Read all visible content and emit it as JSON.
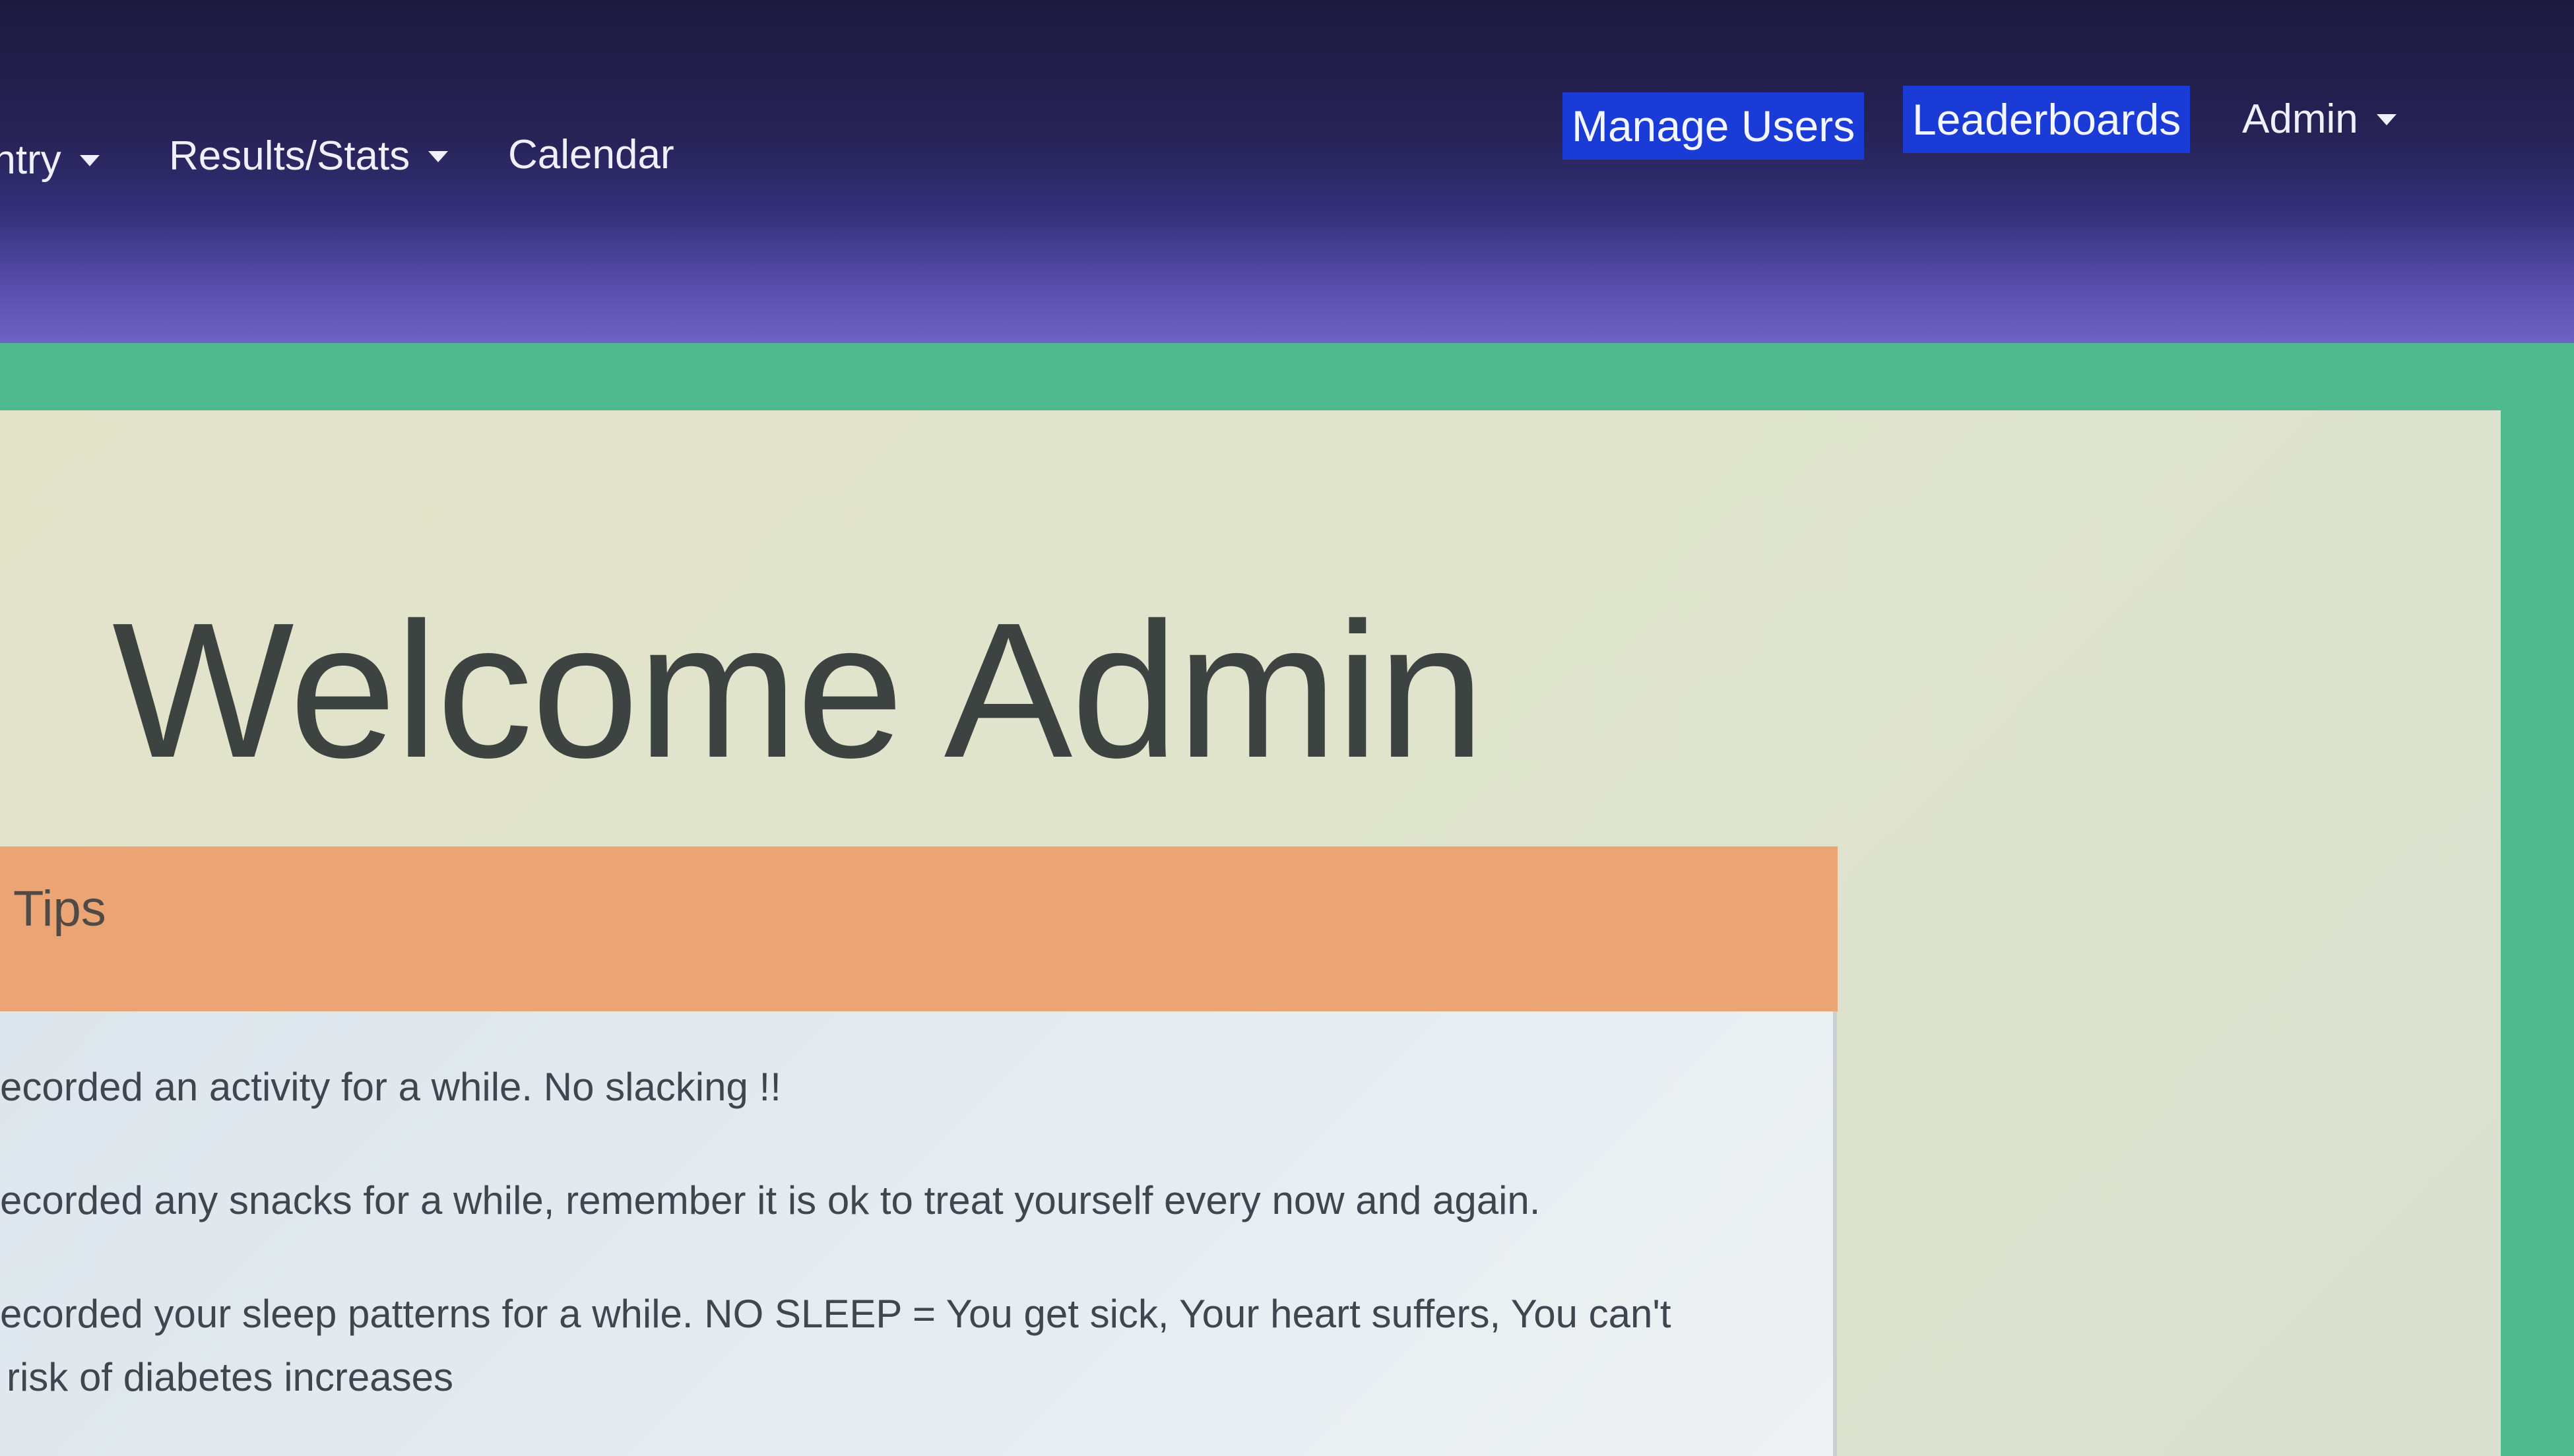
{
  "navbar": {
    "items": [
      {
        "label": "Entry",
        "has_dropdown": true
      },
      {
        "label": "Results/Stats",
        "has_dropdown": true
      },
      {
        "label": "Calendar",
        "has_dropdown": false
      }
    ],
    "right_items": [
      {
        "label": "Manage Users",
        "highlighted": true
      },
      {
        "label": "Leaderboards",
        "highlighted": true
      },
      {
        "label": "Admin",
        "has_dropdown": true
      }
    ]
  },
  "main": {
    "welcome_title": "Welcome Admin"
  },
  "tips": {
    "title": "Tips",
    "items": [
      "ecorded an activity for a while. No slacking !!",
      "ecorded any snacks for a while, remember it is ok to treat yourself every now and again.",
      "ecorded your sleep patterns for a while. NO SLEEP = You get sick, Your heart suffers, You can't",
      "risk of diabetes increases"
    ]
  },
  "colors": {
    "navbar_top": "#1d1a40",
    "navbar_bottom": "#6f62c4",
    "highlight": "#1a3bd6",
    "page_bg": "#4fb98f",
    "tips_header": "#eba574"
  }
}
